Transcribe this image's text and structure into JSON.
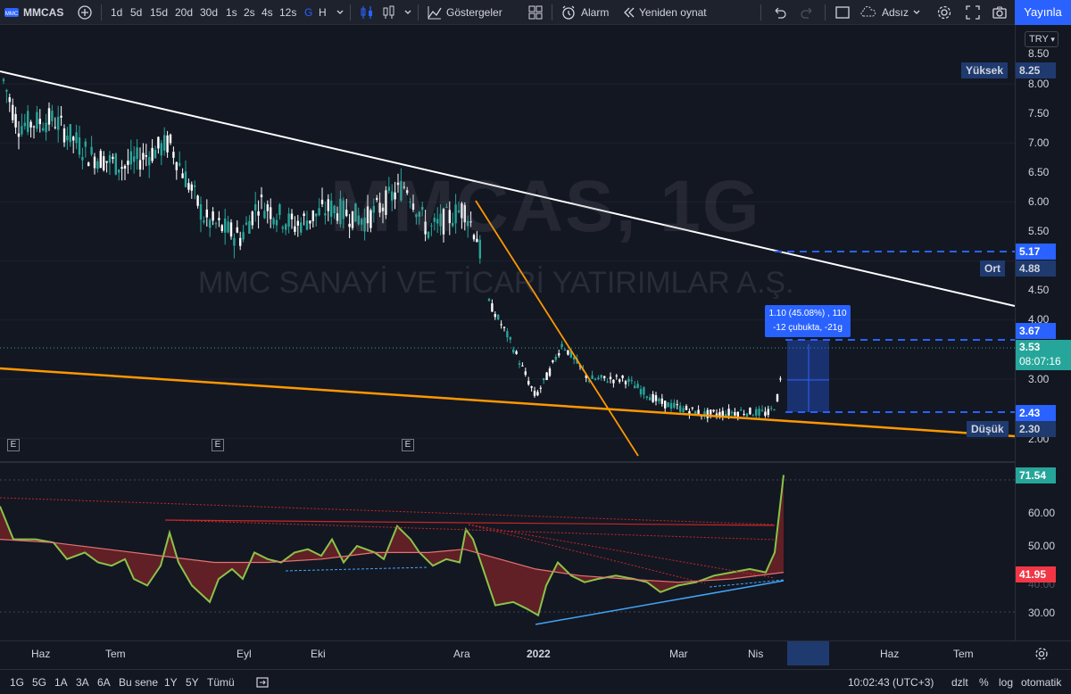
{
  "toolbar": {
    "symbol": "MMCAS",
    "intervals": [
      "1d",
      "5d",
      "15d",
      "20d",
      "30d",
      "1s",
      "2s",
      "4s",
      "12s",
      "G",
      "H"
    ],
    "active_interval": "G",
    "indicators_label": "Göstergeler",
    "alarm_label": "Alarm",
    "replay_label": "Yeniden oynat",
    "layout_name": "Adsız",
    "publish_label": "Yayınla"
  },
  "watermark": {
    "symbol": "MMCAS, 1G",
    "company": "MMC SANAYİ VE TİCARİ YATIRIMLAR A.Ş."
  },
  "price_axis": {
    "currency": "TRY",
    "ticks": [
      "8.50",
      "8.00",
      "7.50",
      "7.00",
      "6.50",
      "6.00",
      "5.50",
      "5.00",
      "4.50",
      "4.00",
      "3.00",
      "2.00"
    ],
    "high_label": "Yüksek",
    "high_value": "8.25",
    "avg_label": "Ort",
    "avg_value": "4.88",
    "low_label": "Düşük",
    "low_value": "2.30",
    "target_upper": "5.17",
    "measure_top": "3.67",
    "last_price": "3.53",
    "countdown": "08:07:16",
    "measure_bottom": "2.43"
  },
  "measure": {
    "line1": "1.10 (45.08%) , 110",
    "line2": "-12 çubukta, -21g"
  },
  "earnings_marker": "E",
  "indicator_axis": {
    "ticks": [
      "60.00",
      "50.00",
      "30.00"
    ],
    "current_value": "71.54",
    "ma_value": "41.95",
    "ma_tick_partial": "40.00"
  },
  "time_axis": {
    "labels": [
      "Haz",
      "Tem",
      "Eyl",
      "Eki",
      "Ara",
      "2022",
      "Mar",
      "Nis",
      "Haz",
      "Tem"
    ]
  },
  "bottom_bar": {
    "ranges": [
      "1G",
      "5G",
      "1A",
      "3A",
      "6A",
      "Bu sene",
      "1Y",
      "5Y",
      "Tümü"
    ],
    "time": "10:02:43 (UTC+3)",
    "adjust": "dzlt",
    "percent": "%",
    "log": "log",
    "auto": "otomatik"
  },
  "colors": {
    "background": "#131722",
    "up": "#26a69a",
    "down": "#ffffff",
    "accent": "#2962ff",
    "trend_white": "#ffffff",
    "trend_orange": "#ff9800",
    "indicator_line": "#8bc34a",
    "indicator_fill_up": "#2e7d32",
    "indicator_fill_down": "#7f1d1d"
  },
  "chart_data": {
    "type": "candlestick",
    "price_unit": "TRY",
    "ylim": [
      2.0,
      8.5
    ],
    "trendlines": [
      "white descending resistance",
      "orange descending support",
      "orange steep descending"
    ],
    "indicator": {
      "current": 71.54,
      "moving_average": 41.95,
      "ylim": [
        25,
        75
      ]
    }
  }
}
